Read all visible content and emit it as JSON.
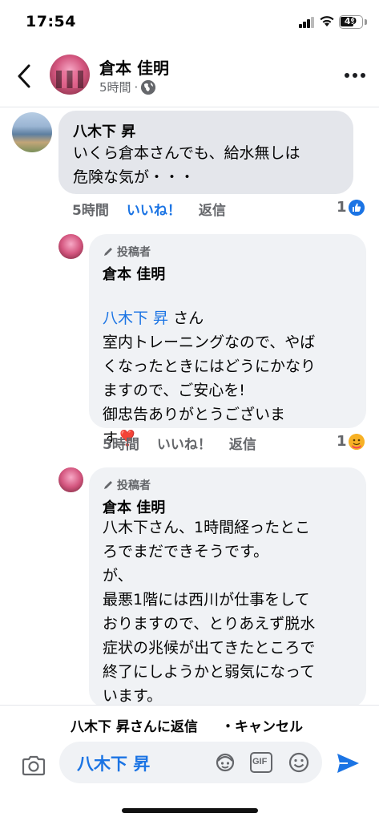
{
  "status_bar": {
    "time": "17:54",
    "battery": "49"
  },
  "header": {
    "name": "倉本 佳明",
    "time": "5時間",
    "separator": "·"
  },
  "comments": [
    {
      "author": "八木下 昇",
      "text": "いくら倉本さんでも、給水無しは\n危険な気が・・・",
      "time": "5時間",
      "like_label": "いいね！",
      "reply_label": "返信",
      "reaction_count": "1"
    },
    {
      "badge": "投稿者",
      "author": "倉本 佳明",
      "mention": "八木下 昇",
      "mention_suffix": " さん",
      "text": "室内トレーニングなので、やば\nくなったときにはどうにかなり\nますので、ご安心を!\n御忠告ありがとうございま\nす",
      "emoji": "❣️",
      "time": "5時間",
      "like_label": "いいね！",
      "reply_label": "返信",
      "reaction_count": "1"
    },
    {
      "badge": "投稿者",
      "author": "倉本 佳明",
      "text": "八木下さん、1時間経ったとこ\nろでまだできそうです。\nが、\n最悪1階には西川が仕事をして\nおりますので、とりあえず脱水\n症状の兆候が出てきたところで\n終了にしようかと弱気になって\nいます。"
    }
  ],
  "reply_bar": {
    "text": "八木下 昇さんに返信",
    "cancel": "・キャンセル"
  },
  "composer": {
    "value": "八木下 昇",
    "gif_label": "GIF"
  },
  "colors": {
    "accent": "#1b74e4",
    "bubble": "#f0f2f5",
    "muted": "#65676b"
  }
}
